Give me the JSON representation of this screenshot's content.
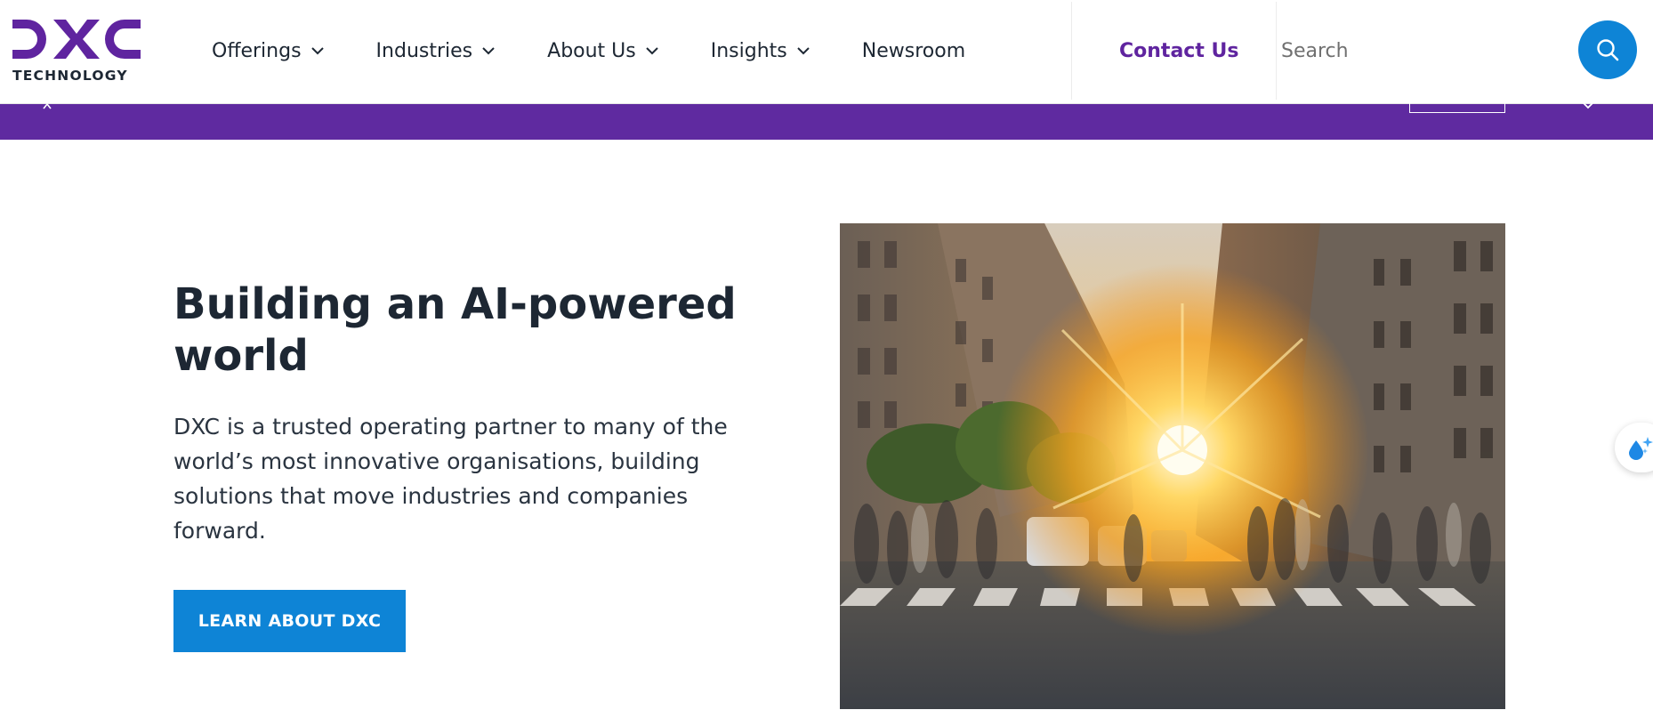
{
  "logo": {
    "name": "DXC",
    "subtitle": "TECHNOLOGY"
  },
  "nav": {
    "items": [
      {
        "label": "Offerings",
        "has_dropdown": true
      },
      {
        "label": "Industries",
        "has_dropdown": true
      },
      {
        "label": "About Us",
        "has_dropdown": true
      },
      {
        "label": "Insights",
        "has_dropdown": true
      },
      {
        "label": "Newsroom",
        "has_dropdown": false
      }
    ]
  },
  "header": {
    "contact_label": "Contact Us",
    "search_placeholder": "Search",
    "search_icon": "search-icon"
  },
  "hero": {
    "title": "Building an AI-powered world",
    "text": "DXC is a trusted operating partner to many of the world’s most innovative organisations, building solutions that move industries and companies forward.",
    "cta_label": "LEARN ABOUT DXC",
    "image_description_icon": "city-street-sunset-photo"
  },
  "side_widget": {
    "icon": "sparkle-drop-icon"
  },
  "colors": {
    "brand_purple": "#5f249f",
    "band_purple": "#5f2aa0",
    "accent_blue": "#0e84d6",
    "text_dark": "#1d2733"
  }
}
